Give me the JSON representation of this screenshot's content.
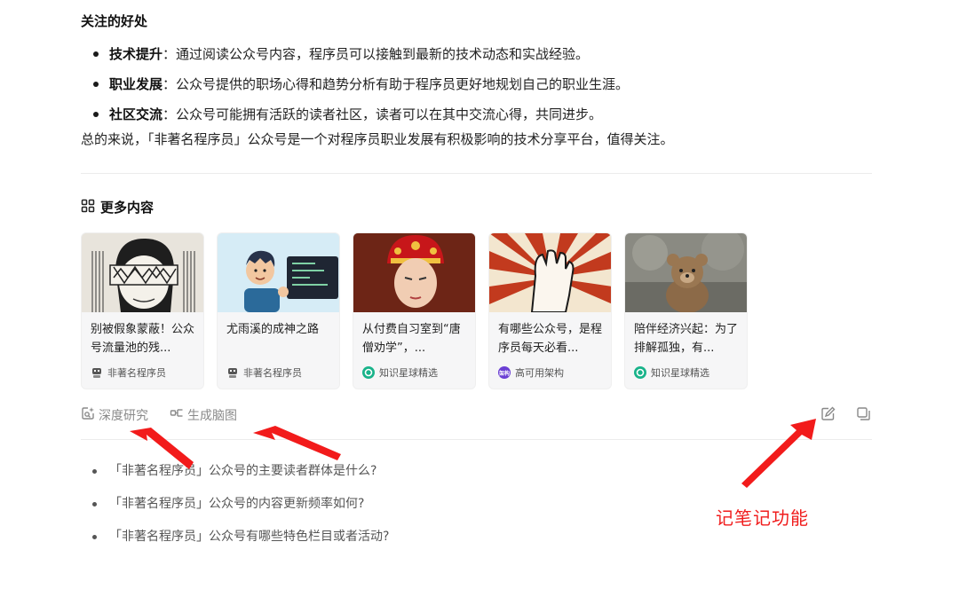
{
  "benefits": {
    "heading": "关注的好处",
    "items": [
      {
        "term": "技术提升",
        "text": "：通过阅读公众号内容，程序员可以接触到最新的技术动态和实战经验。"
      },
      {
        "term": "职业发展",
        "text": "：公众号提供的职场心得和趋势分析有助于程序员更好地规划自己的职业生涯。"
      },
      {
        "term": "社区交流",
        "text": "：公众号可能拥有活跃的读者社区，读者可以在其中交流心得，共同进步。"
      }
    ],
    "summary": "总的来说，「非著名程序员」公众号是一个对程序员职业发展有积极影响的技术分享平台，值得关注。"
  },
  "more": {
    "title": "更多内容",
    "cards": [
      {
        "title": "别被假象蒙蔽！公众号流量池的残...",
        "source": "非著名程序员",
        "source_icon": "robot-avatar-icon"
      },
      {
        "title": "尤雨溪的成神之路",
        "source": "非著名程序员",
        "source_icon": "robot-avatar-icon"
      },
      {
        "title": "从付费自习室到“唐僧劝学”，...",
        "source": "知识星球精选",
        "source_icon": "zsxq-logo-icon"
      },
      {
        "title": "有哪些公众号，是程序员每天必看...",
        "source": "高可用架构",
        "source_icon": "gkyjg-logo-icon",
        "source_badge": "架构"
      },
      {
        "title": "陪伴经济兴起：为了排解孤独，有...",
        "source": "知识星球精选",
        "source_icon": "zsxq-logo-icon"
      }
    ]
  },
  "actions": {
    "deep_research": "深度研究",
    "mind_map": "生成脑图"
  },
  "questions": [
    "「非著名程序员」公众号的主要读者群体是什么?",
    "「非著名程序员」公众号的内容更新频率如何?",
    "「非著名程序员」公众号有哪些特色栏目或者活动?"
  ],
  "annotation": {
    "label": "记笔记功能",
    "color": "#f01d1d"
  },
  "colors": {
    "zsxq_green": "#19b38a",
    "gkyjg_purple": "#6b3fd4"
  }
}
